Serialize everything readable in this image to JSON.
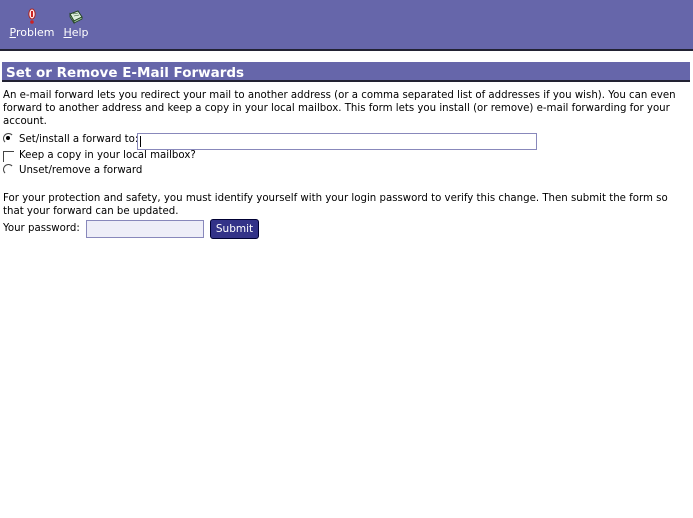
{
  "toolbar": {
    "problem_label_first": "P",
    "problem_label_rest": "roblem",
    "help_label_first": "H",
    "help_label_rest": "elp",
    "problem_icon": "exclamation-icon",
    "help_icon": "book-icon"
  },
  "header": {
    "title": "Set or Remove E-Mail Forwards"
  },
  "intro": {
    "text": "An e-mail forward lets you redirect your mail to another address (or a comma separated list of addresses if you wish). You can even forward to another address and keep a copy in your local mailbox.   This form lets you install (or remove) e-mail forwarding for your account."
  },
  "form": {
    "set_forward_label": "Set/install a forward to:",
    "set_forward_selected": true,
    "forward_value": "",
    "keep_copy_label": "Keep a copy in your local mailbox?",
    "keep_copy_checked": false,
    "unset_forward_label": "Unset/remove a forward",
    "protection_text": "For your protection and safety, you must identify yourself with your login password to verify this change.  Then submit the form so that your forward can be updated.",
    "password_label": "Your password:",
    "password_value": "",
    "submit_label": "Submit"
  },
  "colors": {
    "bar": "#6666aa",
    "button": "#333388"
  }
}
